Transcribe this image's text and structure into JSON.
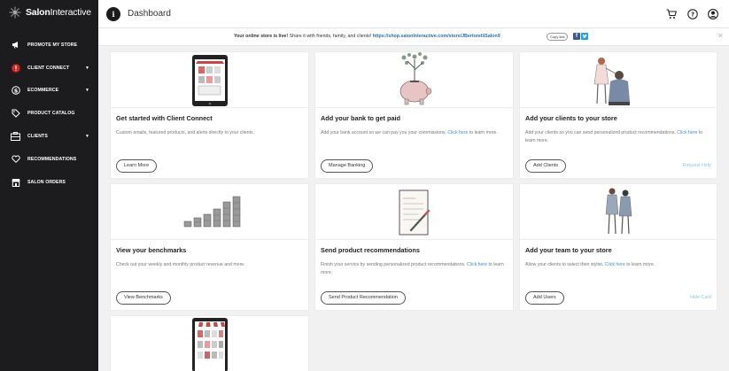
{
  "brand": {
    "name_bold": "Salon",
    "name_rest": "Interactive"
  },
  "sidebar": {
    "items": [
      {
        "label": "PROMOTE MY STORE",
        "icon": "megaphone-icon",
        "has_caret": false
      },
      {
        "label": "CLIENT CONNECT",
        "icon": "alert-circle-icon",
        "has_caret": true,
        "caret": "▼"
      },
      {
        "label": "ECOMMERCE",
        "icon": "dollar-icon",
        "has_caret": true,
        "caret": "▼"
      },
      {
        "label": "PRODUCT CATALOG",
        "icon": "tag-icon",
        "has_caret": false
      },
      {
        "label": "CLIENTS",
        "icon": "clients-icon",
        "has_caret": true,
        "caret": "▼"
      },
      {
        "label": "RECOMMENDATIONS",
        "icon": "heart-icon",
        "has_caret": false
      },
      {
        "label": "SALON ORDERS",
        "icon": "store-icon",
        "has_caret": false
      }
    ]
  },
  "header": {
    "title": "Dashboard",
    "info_glyph": "i"
  },
  "notice": {
    "bold": "Your online store is live!",
    "text": " Share it with friends, family, and clients! ",
    "url": "https://shop.salonInteractive.com/store/JBertorelliSalon9",
    "copy_label": "Copy link",
    "fb_glyph": "f",
    "close": "✕"
  },
  "cards": [
    {
      "title": "Get started with Client Connect",
      "desc": "Custom emails, featured products, and alerts directly to your clients.",
      "button": "Learn More"
    },
    {
      "title": "Add your bank to get paid",
      "desc_pre": "Add your bank account so we can pay you your commissions. ",
      "link": "Click here",
      "desc_post": " to learn more.",
      "button": "Manage Banking"
    },
    {
      "title": "Add your clients to your store",
      "desc_pre": "Add your clients so you can send personalized product recommendations. ",
      "link": "Click here",
      "desc_post": " to learn more.",
      "button": "Add Clients",
      "right_link": "Request Help"
    },
    {
      "title": "View your benchmarks",
      "desc": "Check out your weekly and monthly product revenue and more.",
      "button": "View Benchmarks"
    },
    {
      "title": "Send product recommendations",
      "desc_pre": "Finish your service by sending personalized product recommendations. ",
      "link": "Click here",
      "desc_post": " to learn more.",
      "button": "Send Product Recommendation"
    },
    {
      "title": "Add your team to your store",
      "desc_pre": "Allow your clients to select their stylist. ",
      "link": "Click here",
      "desc_post": " to learn more.",
      "button": "Add Users",
      "right_link": "Hide Card"
    }
  ],
  "colors": {
    "sidebar": "#1c1c1f",
    "link": "#3f8fd6",
    "notice_link": "#2a6fb5",
    "light_link": "#8ec5ec"
  }
}
